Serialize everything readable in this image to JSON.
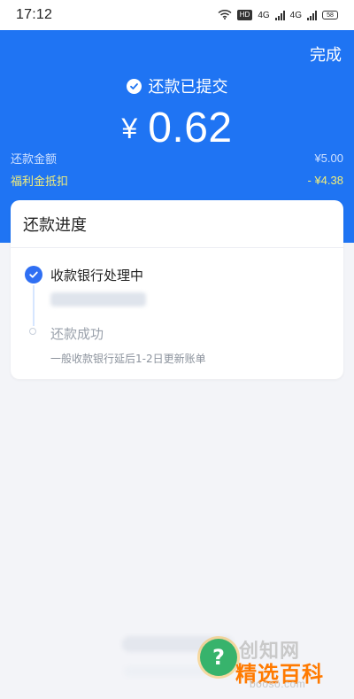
{
  "status_bar": {
    "time": "17:12",
    "hd_label": "HD",
    "network_1": "4G",
    "network_2": "4G",
    "battery": "58"
  },
  "header": {
    "done_label": "完成",
    "submitted_text": "还款已提交",
    "currency_symbol": "¥",
    "amount": "0.62",
    "amount_label": "还款金额",
    "amount_value": "¥5.00",
    "discount_label": "福利金抵扣",
    "discount_value": "- ¥4.38"
  },
  "progress": {
    "title": "还款进度",
    "steps": [
      {
        "title": "收款银行处理中"
      },
      {
        "title": "还款成功",
        "subtitle": "一般收款银行延后1-2日更新账单"
      }
    ]
  },
  "watermark": {
    "brand": "精选百科",
    "domain": "booso.com"
  },
  "colors": {
    "header_blue": "#1f74f3",
    "background": "#f3f4f8",
    "discount_yellow": "#f2ee7a"
  },
  "icons": {
    "submitted": "check-circle-icon",
    "step_done": "check-icon",
    "step_pending": "circle-outline-icon",
    "wifi": "wifi-icon",
    "signal": "signal-icon",
    "battery": "battery-icon",
    "watermark": "question-circle-icon"
  }
}
